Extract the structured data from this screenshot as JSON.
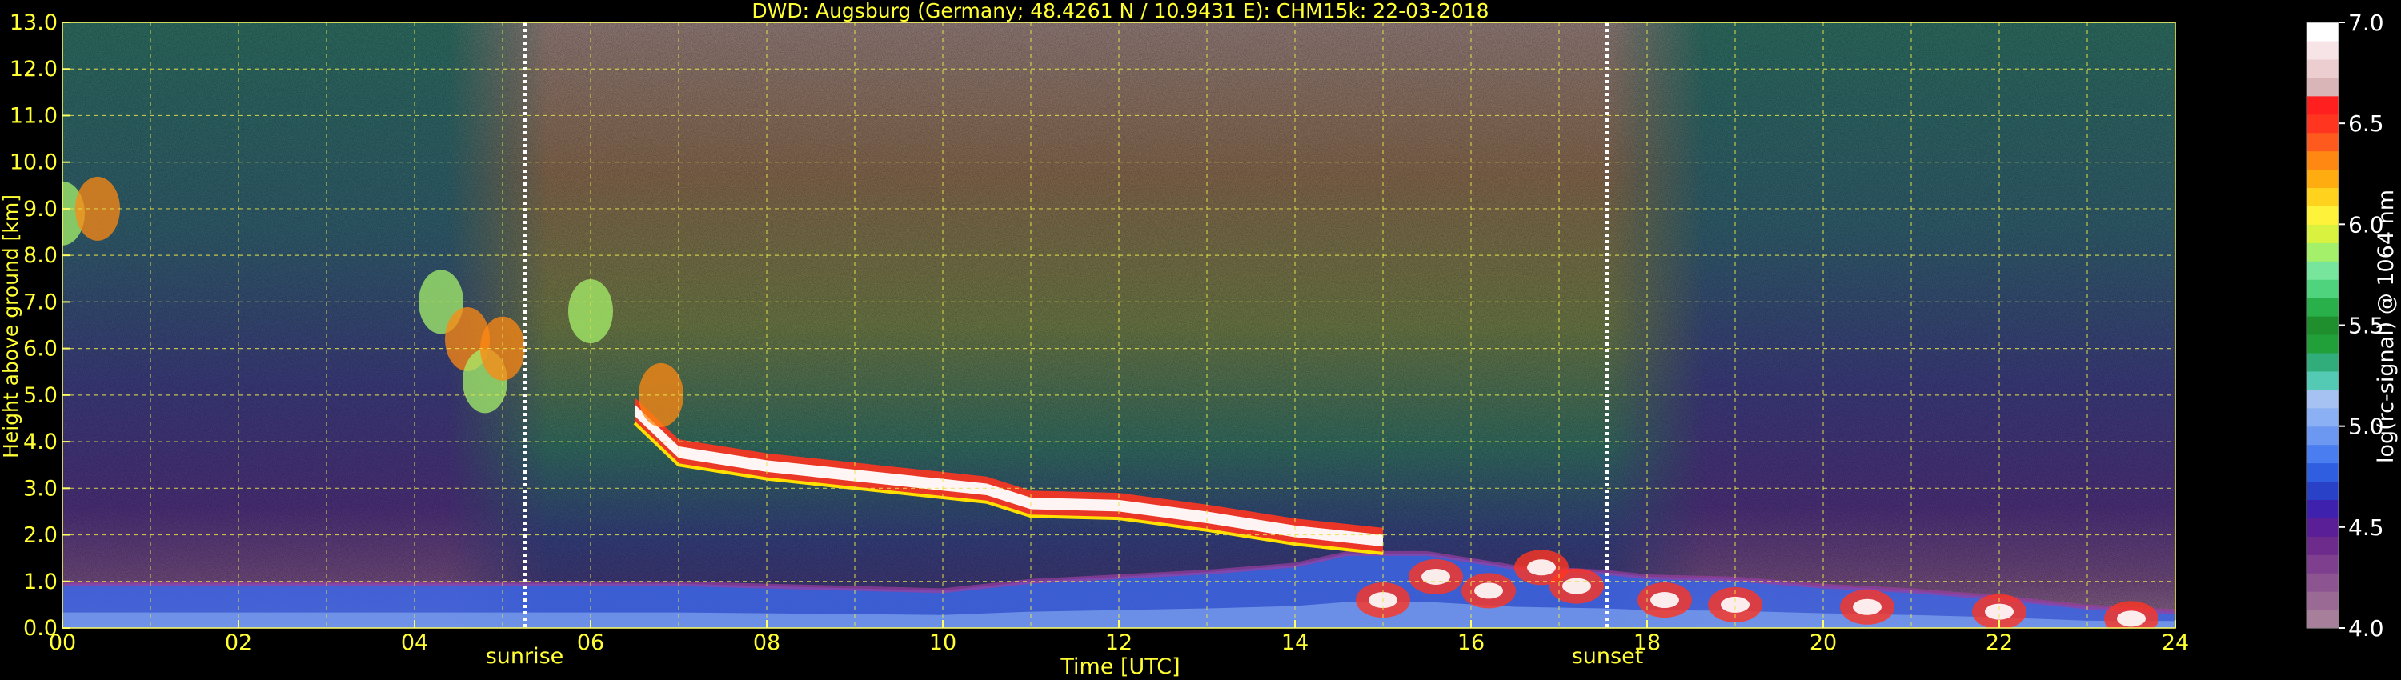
{
  "chart_data": {
    "type": "heatmap",
    "title": "DWD: Augsburg (Germany; 48.4261 N / 10.9431 E):    CHM15k: 22-03-2018",
    "xlabel": "Time [UTC]",
    "ylabel": "Height above ground [km]",
    "xlim": [
      0,
      24
    ],
    "ylim": [
      0,
      13
    ],
    "x_ticks": [
      "00",
      "02",
      "04",
      "06",
      "08",
      "10",
      "12",
      "14",
      "16",
      "18",
      "20",
      "22",
      "24"
    ],
    "y_ticks": [
      "0.0",
      "1.0",
      "2.0",
      "3.0",
      "4.0",
      "5.0",
      "6.0",
      "7.0",
      "8.0",
      "9.0",
      "10.0",
      "11.0",
      "12.0",
      "13.0"
    ],
    "grid": true,
    "colorbar": {
      "label": "log(rc-signal) @ 1064 nm",
      "range": [
        4.0,
        7.0
      ],
      "ticks": [
        "4.0",
        "4.5",
        "5.0",
        "5.5",
        "6.0",
        "6.5",
        "7.0"
      ],
      "colors": [
        "#a87f9a",
        "#9a6a95",
        "#8c5592",
        "#7e3f8e",
        "#6d2b8c",
        "#5a1f96",
        "#3e21ad",
        "#2941c6",
        "#2f5ee0",
        "#4a7ef0",
        "#6d98f2",
        "#8bb0f3",
        "#a5c2f2",
        "#54c9b4",
        "#30ad7a",
        "#21a03a",
        "#1e8f2c",
        "#29b04b",
        "#4fd47d",
        "#77e59b",
        "#a5f06a",
        "#d8f23f",
        "#fff23a",
        "#ffd21d",
        "#ffac10",
        "#ff8812",
        "#ff5a1e",
        "#ff3520",
        "#ff1f1f",
        "#d9b5b8",
        "#eccdd0",
        "#f6e4e6",
        "#ffffff"
      ]
    },
    "annotations": [
      {
        "text": "sunrise",
        "x": 5.25
      },
      {
        "text": "sunset",
        "x": 17.55
      }
    ],
    "features": {
      "boundary_layer_top_km": [
        [
          0,
          0.95
        ],
        [
          2,
          0.95
        ],
        [
          4,
          0.95
        ],
        [
          6,
          0.95
        ],
        [
          7,
          0.95
        ],
        [
          8,
          0.9
        ],
        [
          10,
          0.8
        ],
        [
          11,
          1.0
        ],
        [
          12,
          1.1
        ],
        [
          13,
          1.2
        ],
        [
          14,
          1.35
        ],
        [
          14.6,
          1.6
        ],
        [
          15.5,
          1.6
        ],
        [
          16.5,
          1.3
        ],
        [
          17.5,
          1.2
        ],
        [
          18,
          1.1
        ],
        [
          19,
          1.05
        ],
        [
          20,
          0.9
        ],
        [
          21,
          0.8
        ],
        [
          22,
          0.65
        ],
        [
          23,
          0.45
        ],
        [
          24,
          0.35
        ]
      ],
      "cloud_base_km": [
        [
          6.5,
          4.4
        ],
        [
          7,
          3.5
        ],
        [
          8,
          3.2
        ],
        [
          9,
          3.0
        ],
        [
          10,
          2.8
        ],
        [
          10.5,
          2.7
        ],
        [
          11,
          2.4
        ],
        [
          12,
          2.35
        ],
        [
          13,
          2.1
        ],
        [
          14,
          1.8
        ],
        [
          15,
          1.6
        ]
      ],
      "cirrus_km": [
        [
          0,
          8.9
        ],
        [
          0.4,
          9.0
        ],
        [
          4.3,
          7.0
        ],
        [
          4.6,
          6.2
        ],
        [
          4.8,
          5.3
        ],
        [
          5.0,
          6.0
        ],
        [
          6.0,
          6.8
        ],
        [
          6.8,
          5.0
        ]
      ]
    }
  }
}
